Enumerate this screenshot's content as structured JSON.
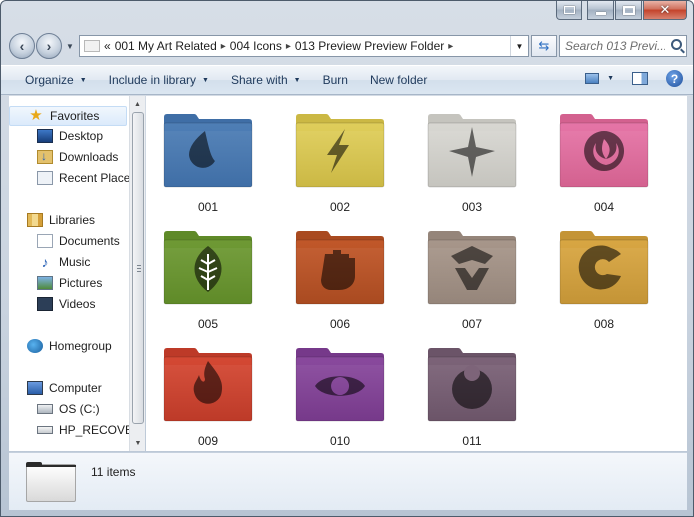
{
  "window": {
    "caption_buttons": [
      "extra",
      "minimize",
      "maximize",
      "close"
    ]
  },
  "address": {
    "overflow": "«",
    "crumbs": [
      "001 My Art Related",
      "004 Icons",
      "013 Preview Preview Folder"
    ]
  },
  "search": {
    "placeholder": "Search 013 Previ..."
  },
  "toolbar": {
    "organize": "Organize",
    "include_in_library": "Include in library",
    "share_with": "Share with",
    "burn": "Burn",
    "new_folder": "New folder",
    "help": "?"
  },
  "nav": {
    "favorites": "Favorites",
    "desktop": "Desktop",
    "downloads": "Downloads",
    "recent_places": "Recent Place",
    "libraries": "Libraries",
    "documents": "Documents",
    "music": "Music",
    "pictures": "Pictures",
    "videos": "Videos",
    "homegroup": "Homegroup",
    "computer": "Computer",
    "os_drive": "OS (C:)",
    "recovery_drive": "HP_RECOVER"
  },
  "folders": [
    {
      "name": "001",
      "color": "#4f7fb6",
      "tab": "#3f6ea6",
      "symbol": "water"
    },
    {
      "name": "002",
      "color": "#e0cf5c",
      "tab": "#cbb844",
      "symbol": "lightning"
    },
    {
      "name": "003",
      "color": "#d9d8d3",
      "tab": "#c5c4be",
      "symbol": "star"
    },
    {
      "name": "004",
      "color": "#e676a8",
      "tab": "#d3618f",
      "symbol": "psychic"
    },
    {
      "name": "005",
      "color": "#6f9a35",
      "tab": "#5f8a28",
      "symbol": "leaf"
    },
    {
      "name": "006",
      "color": "#c2582a",
      "tab": "#a94a20",
      "symbol": "fist"
    },
    {
      "name": "007",
      "color": "#a8978b",
      "tab": "#95857a",
      "symbol": "metal"
    },
    {
      "name": "008",
      "color": "#d9a743",
      "tab": "#c49436",
      "symbol": "dragon"
    },
    {
      "name": "009",
      "color": "#d54934",
      "tab": "#bd3a28",
      "symbol": "fire"
    },
    {
      "name": "010",
      "color": "#8a4a9e",
      "tab": "#76398a",
      "symbol": "eye"
    },
    {
      "name": "011",
      "color": "#7d6479",
      "tab": "#6b5468",
      "symbol": "dark"
    }
  ],
  "details": {
    "count": "11 items"
  }
}
